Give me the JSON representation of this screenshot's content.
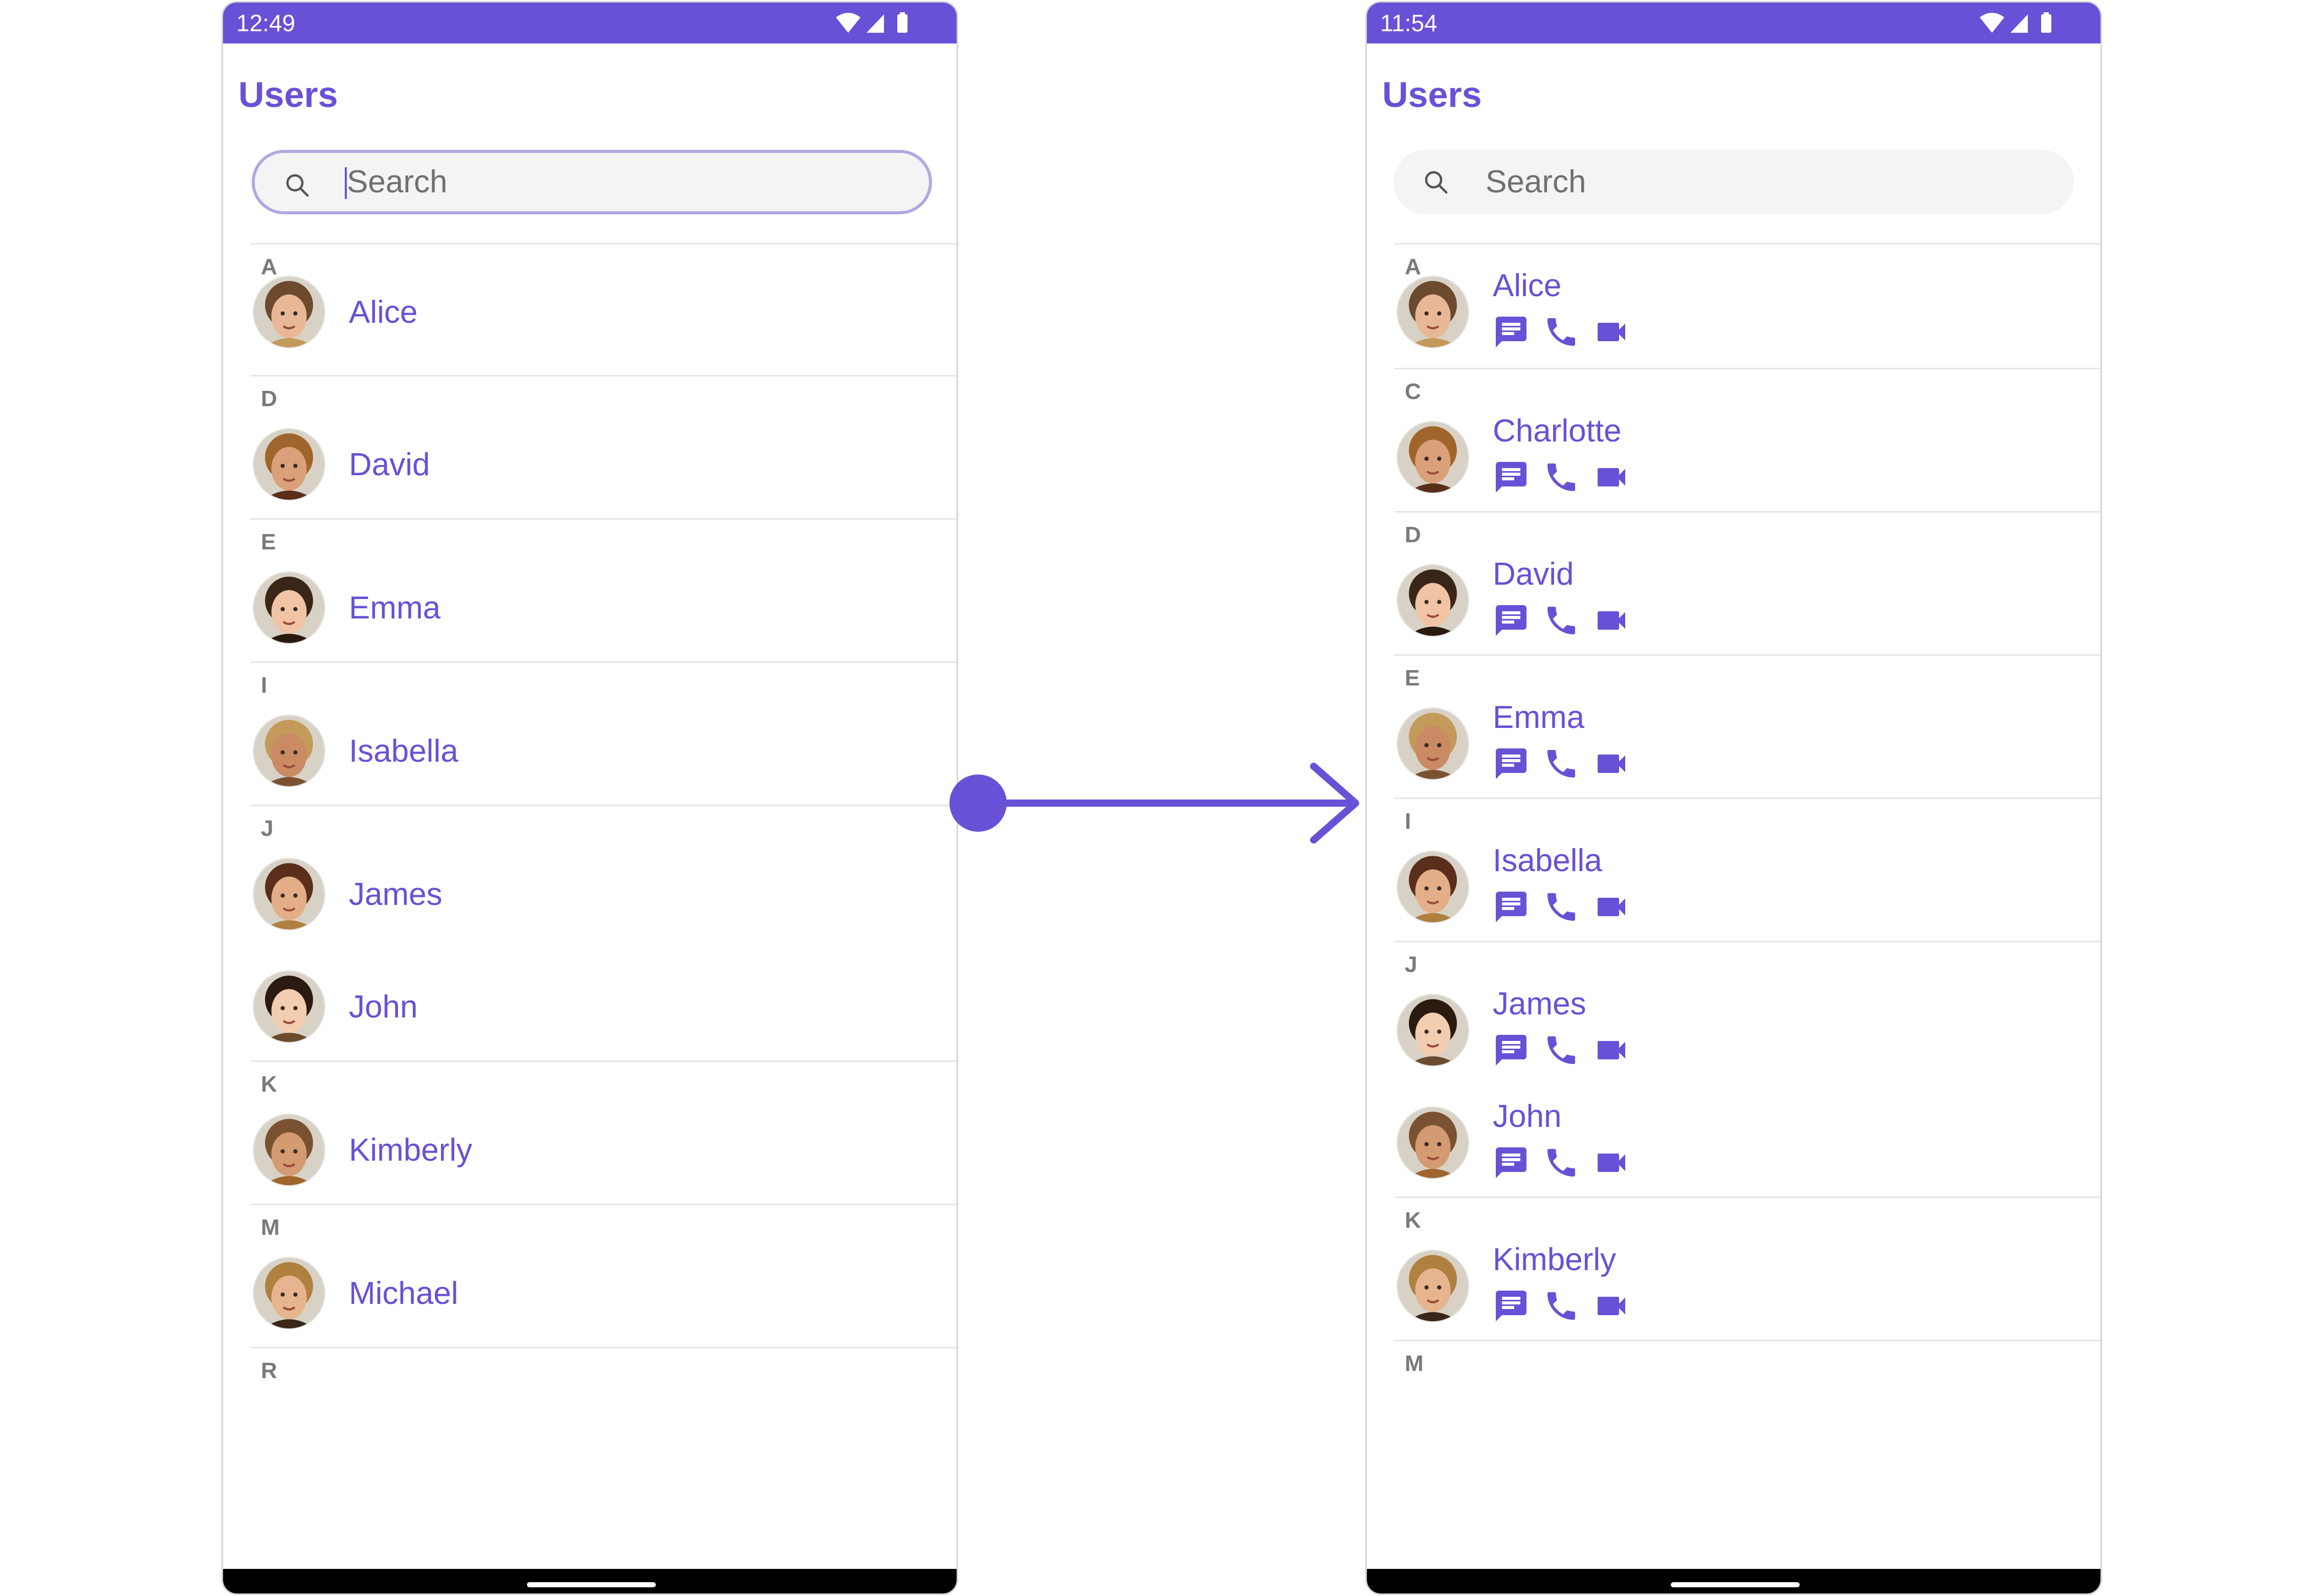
{
  "colors": {
    "accent": "#6851d6",
    "status_bar": "#6851d6",
    "divider": "#e6e6e6"
  },
  "left": {
    "time": "12:49",
    "title": "Users",
    "search_placeholder": "Search",
    "sections": [
      {
        "letter": "A",
        "users": [
          "Alice"
        ]
      },
      {
        "letter": "D",
        "users": [
          "David"
        ]
      },
      {
        "letter": "E",
        "users": [
          "Emma"
        ]
      },
      {
        "letter": "I",
        "users": [
          "Isabella"
        ]
      },
      {
        "letter": "J",
        "users": [
          "James",
          "John"
        ]
      },
      {
        "letter": "K",
        "users": [
          "Kimberly"
        ]
      },
      {
        "letter": "M",
        "users": [
          "Michael"
        ]
      },
      {
        "letter": "R",
        "users": []
      }
    ]
  },
  "right": {
    "time": "11:54",
    "title": "Users",
    "search_placeholder": "Search",
    "action_icons": [
      "message-icon",
      "phone-icon",
      "video-icon"
    ],
    "sections": [
      {
        "letter": "A",
        "users": [
          "Alice"
        ]
      },
      {
        "letter": "C",
        "users": [
          "Charlotte"
        ]
      },
      {
        "letter": "D",
        "users": [
          "David"
        ]
      },
      {
        "letter": "E",
        "users": [
          "Emma"
        ]
      },
      {
        "letter": "I",
        "users": [
          "Isabella"
        ]
      },
      {
        "letter": "J",
        "users": [
          "James",
          "John"
        ]
      },
      {
        "letter": "K",
        "users": [
          "Kimberly"
        ]
      },
      {
        "letter": "M",
        "users": []
      }
    ]
  }
}
